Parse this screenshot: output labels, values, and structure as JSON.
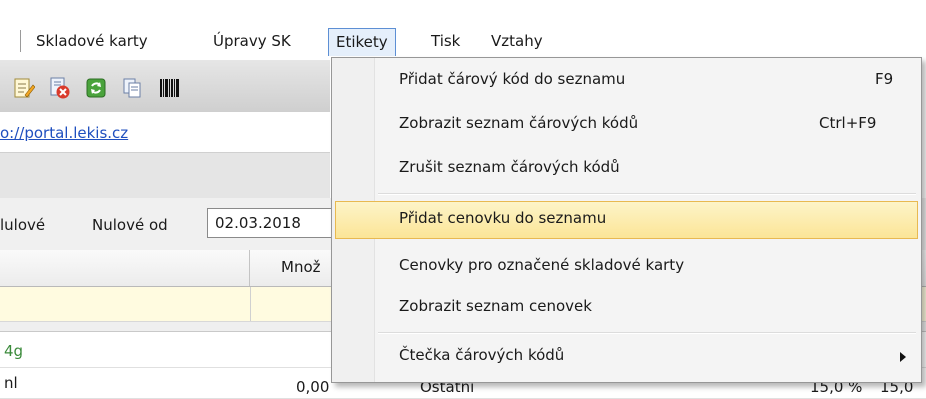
{
  "menubar": {
    "items": [
      "Skladové karty",
      "Úpravy SK",
      "Etikety",
      "Tisk",
      "Vztahy"
    ]
  },
  "toolbar": {
    "icons": [
      "edit-note-icon",
      "delete-document-icon",
      "refresh-icon",
      "copy-document-icon",
      "barcode-icon"
    ]
  },
  "link": {
    "text": "o://portal.lekis.cz"
  },
  "filter": {
    "label_partial": "lulové",
    "label_from": "Nulové od",
    "date": "02.03.2018"
  },
  "grid": {
    "col_header_partial": "Množ",
    "rows": [
      {
        "name_partial": "4g"
      },
      {
        "name_partial": "nl",
        "qty": "0,00",
        "group": "Ostatní",
        "pct1": "15,0 %",
        "pct2": "15,0"
      }
    ]
  },
  "dropdown": {
    "items": [
      {
        "label": "Přidat čárový kód do seznamu",
        "shortcut": "F9"
      },
      {
        "label": "Zobrazit seznam čárových kódů",
        "shortcut": "Ctrl+F9"
      },
      {
        "label": "Zrušit seznam čárových kódů",
        "shortcut": ""
      },
      {
        "label": "Přidat cenovku do seznamu",
        "shortcut": ""
      },
      {
        "label": "Cenovky pro označené skladové karty",
        "shortcut": ""
      },
      {
        "label": "Zobrazit seznam cenovek",
        "shortcut": ""
      },
      {
        "label": "Čtečka čárových kódů",
        "shortcut": ""
      }
    ],
    "highlighted_index": 3
  },
  "colors": {
    "highlight": "#fbe597",
    "link": "#1f4fbf",
    "active_menu": "#e5effb"
  }
}
